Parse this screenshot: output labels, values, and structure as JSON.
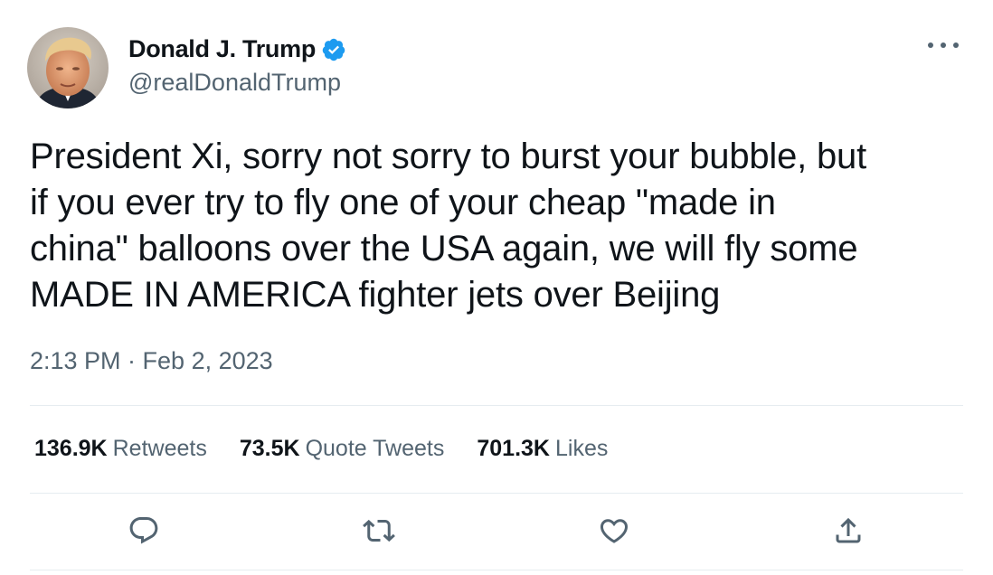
{
  "author": {
    "display_name": "Donald J. Trump",
    "handle": "@realDonaldTrump",
    "verified": true,
    "avatar_icon": "avatar-photo"
  },
  "tweet": {
    "text": "President Xi, sorry not sorry to burst your bubble, but\nif you ever try to fly  one of your cheap \"made in\nchina\" balloons over the USA again, we will fly some\nMADE IN AMERICA fighter jets over Beijing",
    "timestamp": "2:13 PM · Feb 2, 2023"
  },
  "stats": {
    "retweets_count": "136.9K",
    "retweets_label": "Retweets",
    "quotes_count": "73.5K",
    "quotes_label": "Quote Tweets",
    "likes_count": "701.3K",
    "likes_label": "Likes"
  },
  "actions": [
    "reply-icon",
    "retweet-icon",
    "like-icon",
    "share-icon"
  ],
  "colors": {
    "text": "#0f1419",
    "secondary": "#536471",
    "verified_blue": "#1d9bf0",
    "divider": "#e6ecf0"
  }
}
